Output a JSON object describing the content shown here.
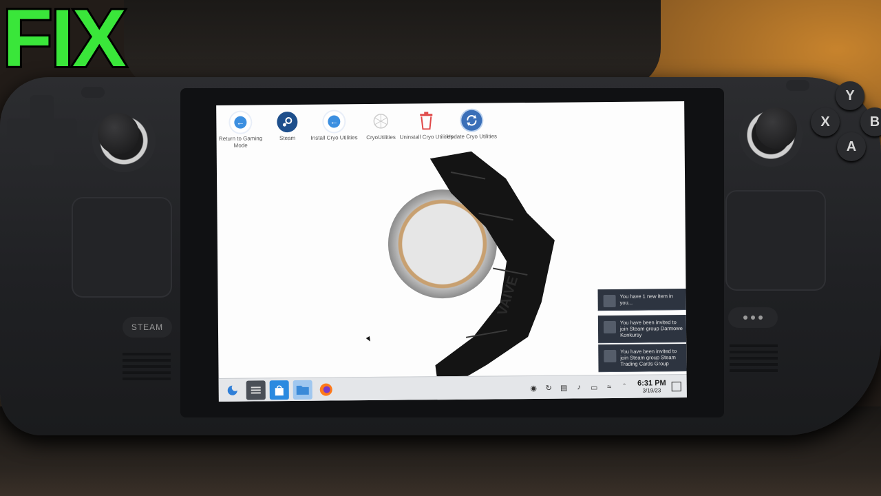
{
  "overlay": {
    "title": "FIX"
  },
  "device": {
    "steam_button": "STEAM",
    "face_buttons": {
      "y": "Y",
      "x": "X",
      "b": "B",
      "a": "A"
    }
  },
  "desktop": {
    "icons": [
      {
        "label": "Return to Gaming Mode",
        "icon": "back-arrow-icon"
      },
      {
        "label": "Steam",
        "icon": "steam-icon"
      },
      {
        "label": "Install Cryo Utilities",
        "icon": "back-arrow-icon"
      },
      {
        "label": "CryoUtilities",
        "icon": "cryo-icon"
      },
      {
        "label": "Uninstall Cryo Utilities",
        "icon": "trash-icon"
      },
      {
        "label": "Update Cryo Utilities",
        "icon": "update-icon"
      }
    ],
    "tape_print": "VAIVE"
  },
  "notifications": [
    {
      "text": "You have 1 new item in you..."
    },
    {
      "text": "You have been invited to join Steam group Darmowe Konkursy"
    },
    {
      "text": "You have been invited to join Steam group Steam Trading Cards Group"
    }
  ],
  "taskbar": {
    "apps": [
      "app-launcher-icon",
      "system-settings-icon",
      "discover-store-icon",
      "file-manager-icon",
      "firefox-icon"
    ],
    "clock": {
      "time": "6:31 PM",
      "date": "3/19/23"
    }
  },
  "colors": {
    "fix_text": "#3ae63a",
    "steam_blue": "#1e4f8c",
    "accent_blue": "#3c8fe0"
  }
}
